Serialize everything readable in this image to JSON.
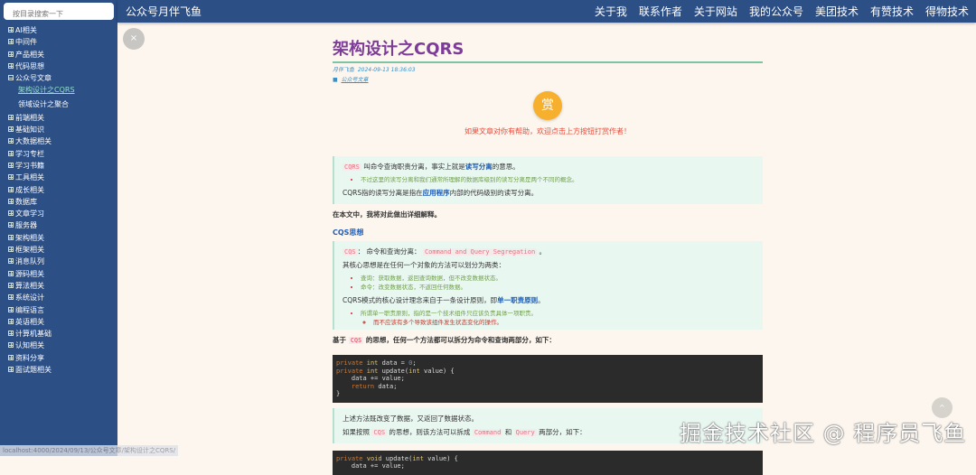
{
  "search": {
    "placeholder": "按目录搜索一下"
  },
  "brand": "公众号月伴飞鱼",
  "nav": [
    "关于我",
    "联系作者",
    "关于网站",
    "我的公众号",
    "美团技术",
    "有赞技术",
    "得物技术"
  ],
  "tree": {
    "before": [
      "AI相关",
      "中间件",
      "产品相关",
      "代码思想"
    ],
    "open": "公众号文章",
    "children": [
      "架构设计之CQRS",
      "领域设计之聚合"
    ],
    "after": [
      "前端相关",
      "基础知识",
      "大数据相关",
      "学习专栏",
      "学习书籍",
      "工具相关",
      "成长相关",
      "数据库",
      "文章学习",
      "服务器",
      "架构相关",
      "框架相关",
      "消息队列",
      "源码相关",
      "算法相关",
      "系统设计",
      "编程语言",
      "英语相关",
      "计算机基础",
      "认知相关",
      "资料分享",
      "面试题相关"
    ]
  },
  "article": {
    "title": "架构设计之CQRS",
    "author": "月伴飞鱼",
    "date": "2024-09-13 18:36:03",
    "category": "公众号文章",
    "reward_label": "赏",
    "reward_text": "如果文章对你有帮助，欢迎点击上方按钮打赏作者！",
    "q1": {
      "code": "CQRS",
      "t1": " 叫命令查询职责分离，事实上就是",
      "hl": "读写分离",
      "t2": "的意思。",
      "li": "不过这里的读写分离和我们通常所理解的数据库级别的读写分离是两个不同的概念。",
      "p2a": "CQRS指的读写分离是指在",
      "p2hl": "应用程序",
      "p2b": "内部的代码级别的读写分离。"
    },
    "p3": "在本文中，我将对此做出详细解释。",
    "h_cqs": "CQS思想",
    "q2": {
      "code": "CQS",
      "t1": "： 命令和查询分离： ",
      "code2": "Command and Query Segregation",
      "t2": " 。",
      "p1": "其核心思想是在任何一个对象的方法可以划分为两类：",
      "li": [
        "查询：获取数据，返回查询数据，但不改变数据状态。",
        "命令：改变数据状态，不返回任何数据。"
      ],
      "p2a": "CQRS模式的核心设计理念来自于一条设计原则，即",
      "p2hl": "单一职责原则",
      "p2b": "。",
      "li2": "所谓单一职责原则，指的是一个技术组件只应该负责具体一项职责。",
      "li3": "而不应该有多个导致该组件发生状态变化的操作。"
    },
    "p4": {
      "a": "基于 ",
      "code": "CQS",
      "b": " 的思想，任何一个方法都可以拆分为命令和查询两部分，如下："
    },
    "code1": [
      "private int data = 0;",
      "private int update(int value) {",
      "    data += value;",
      "    return data;",
      "}"
    ],
    "q3": {
      "p1": "上述方法既改变了数据，又返回了数据状态。",
      "a": "如果按照 ",
      "code": "CQS",
      "b": " 的思想，则该方法可以拆成 ",
      "c1": "Command",
      "c": " 和 ",
      "c2": "Query",
      "d": " 两部分，如下："
    },
    "code2": [
      "private void update(int value) {",
      "    data += value;"
    ]
  },
  "watermark": "掘金技术社区 @ 程序员飞鱼",
  "status_url": "localhost:4000/2024/09/13/公众号文章/架构设计之CQRS/",
  "close_label": "×",
  "up_label": "^"
}
